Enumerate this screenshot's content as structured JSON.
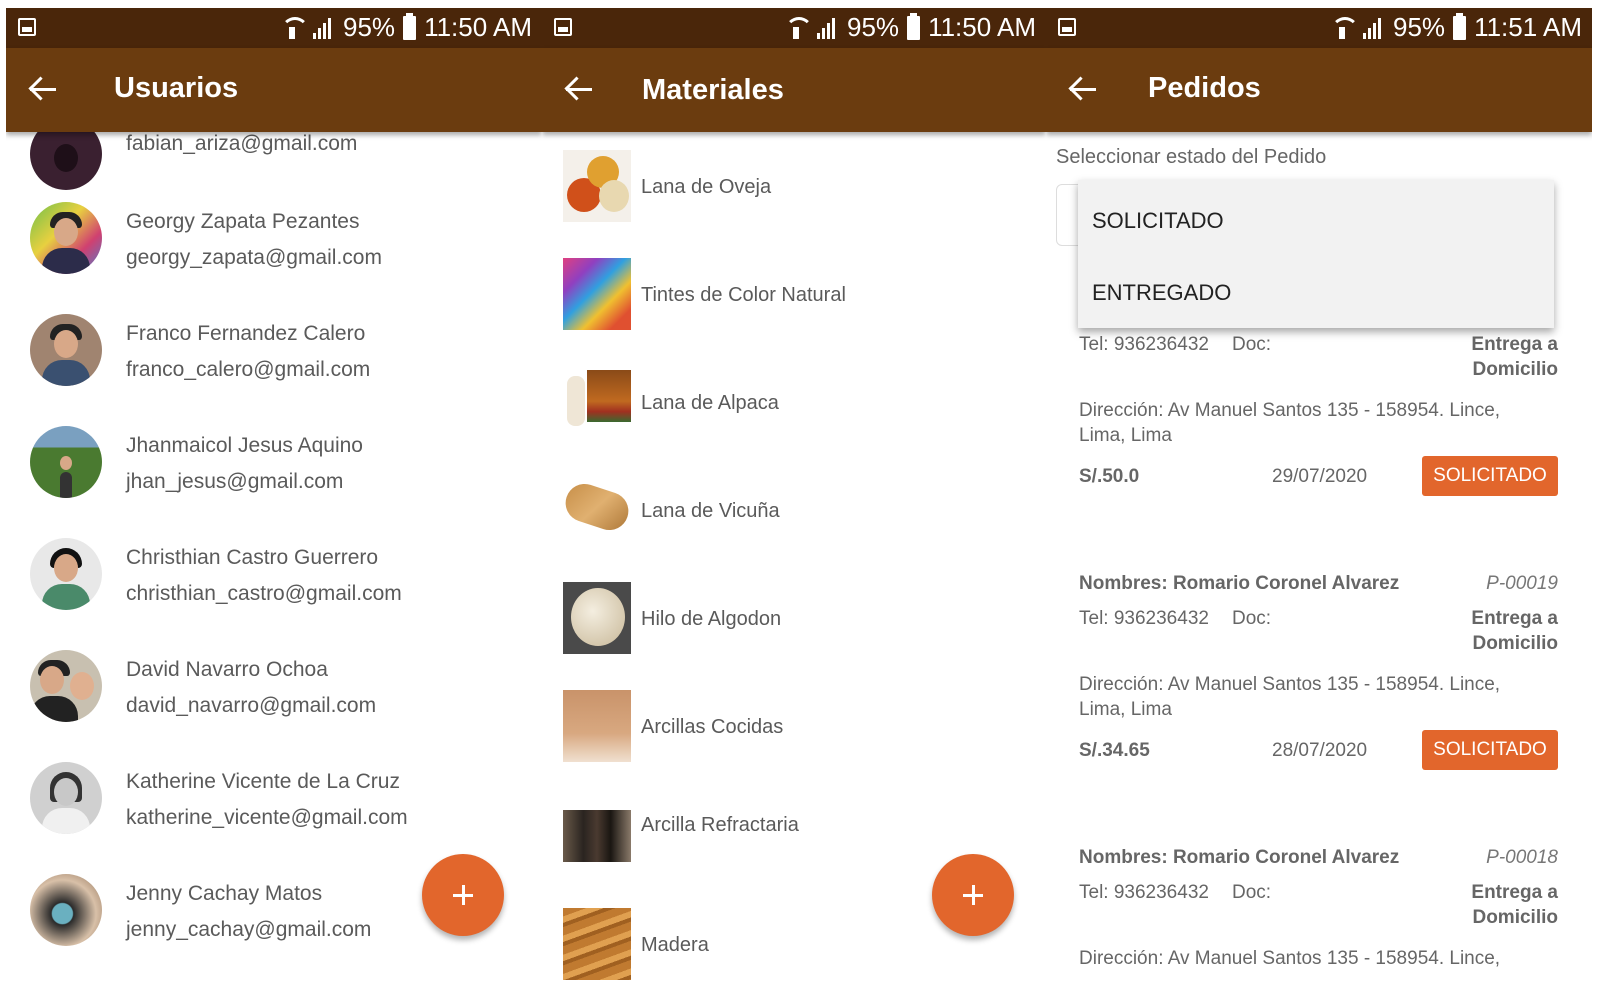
{
  "status": {
    "panel1": {
      "battery": "95%",
      "time": "11:50 AM"
    },
    "panel2": {
      "battery": "95%",
      "time": "11:50 AM"
    },
    "panel3": {
      "battery": "95%",
      "time": "11:51 AM"
    }
  },
  "usuarios": {
    "title": "Usuarios",
    "partial_email": "fabian_ariza@gmail.com",
    "users": [
      {
        "name": "Georgy  Zapata Pezantes",
        "email": "georgy_zapata@gmail.com"
      },
      {
        "name": "Franco Fernandez Calero",
        "email": "franco_calero@gmail.com"
      },
      {
        "name": "Jhanmaicol Jesus Aquino",
        "email": "jhan_jesus@gmail.com"
      },
      {
        "name": "Christhian Castro Guerrero",
        "email": "christhian_castro@gmail.com"
      },
      {
        "name": "David Navarro Ochoa",
        "email": "david_navarro@gmail.com"
      },
      {
        "name": "Katherine Vicente de La Cruz",
        "email": "katherine_vicente@gmail.com"
      },
      {
        "name": "Jenny Cachay Matos",
        "email": "jenny_cachay@gmail.com"
      }
    ],
    "fab": "+"
  },
  "materiales": {
    "title": "Materiales",
    "items": [
      {
        "label": "Lana de Oveja"
      },
      {
        "label": "Tintes de Color Natural"
      },
      {
        "label": "Lana de Alpaca"
      },
      {
        "label": "Lana de Vicuña"
      },
      {
        "label": "Hilo de Algodon"
      },
      {
        "label": "Arcillas Cocidas"
      },
      {
        "label": "Arcilla Refractaria"
      },
      {
        "label": "Madera"
      }
    ],
    "fab": "+"
  },
  "pedidos": {
    "title": "Pedidos",
    "select_label": "Seleccionar estado del Pedido",
    "dropdown_options": [
      "SOLICITADO",
      "ENTREGADO"
    ],
    "orders": [
      {
        "name": "",
        "code": "",
        "tel": "Tel: 936236432",
        "doc": "Doc:",
        "delivery": [
          "Entrega a",
          "Domicilio"
        ],
        "address": [
          "Dirección: Av Manuel Santos 135 - 158954. Lince,",
          "Lima, Lima"
        ],
        "amount": "S/.50.0",
        "date": "29/07/2020",
        "status": "SOLICITADO"
      },
      {
        "name": "Nombres: Romario Coronel Alvarez",
        "code": "P-00019",
        "tel": "Tel: 936236432",
        "doc": "Doc:",
        "delivery": [
          "Entrega a",
          "Domicilio"
        ],
        "address": [
          "Dirección: Av Manuel Santos 135 - 158954. Lince,",
          "Lima, Lima"
        ],
        "amount": "S/.34.65",
        "date": "28/07/2020",
        "status": "SOLICITADO"
      },
      {
        "name": "Nombres: Romario Coronel Alvarez",
        "code": "P-00018",
        "tel": "Tel: 936236432",
        "doc": "Doc:",
        "delivery": [
          "Entrega a",
          "Domicilio"
        ],
        "address": [
          "Dirección: Av Manuel Santos 135 - 158954. Lince,"
        ]
      }
    ]
  },
  "colors": {
    "status_bar": "#4a260a",
    "app_bar": "#6b3c0f",
    "accent": "#e2662c"
  }
}
